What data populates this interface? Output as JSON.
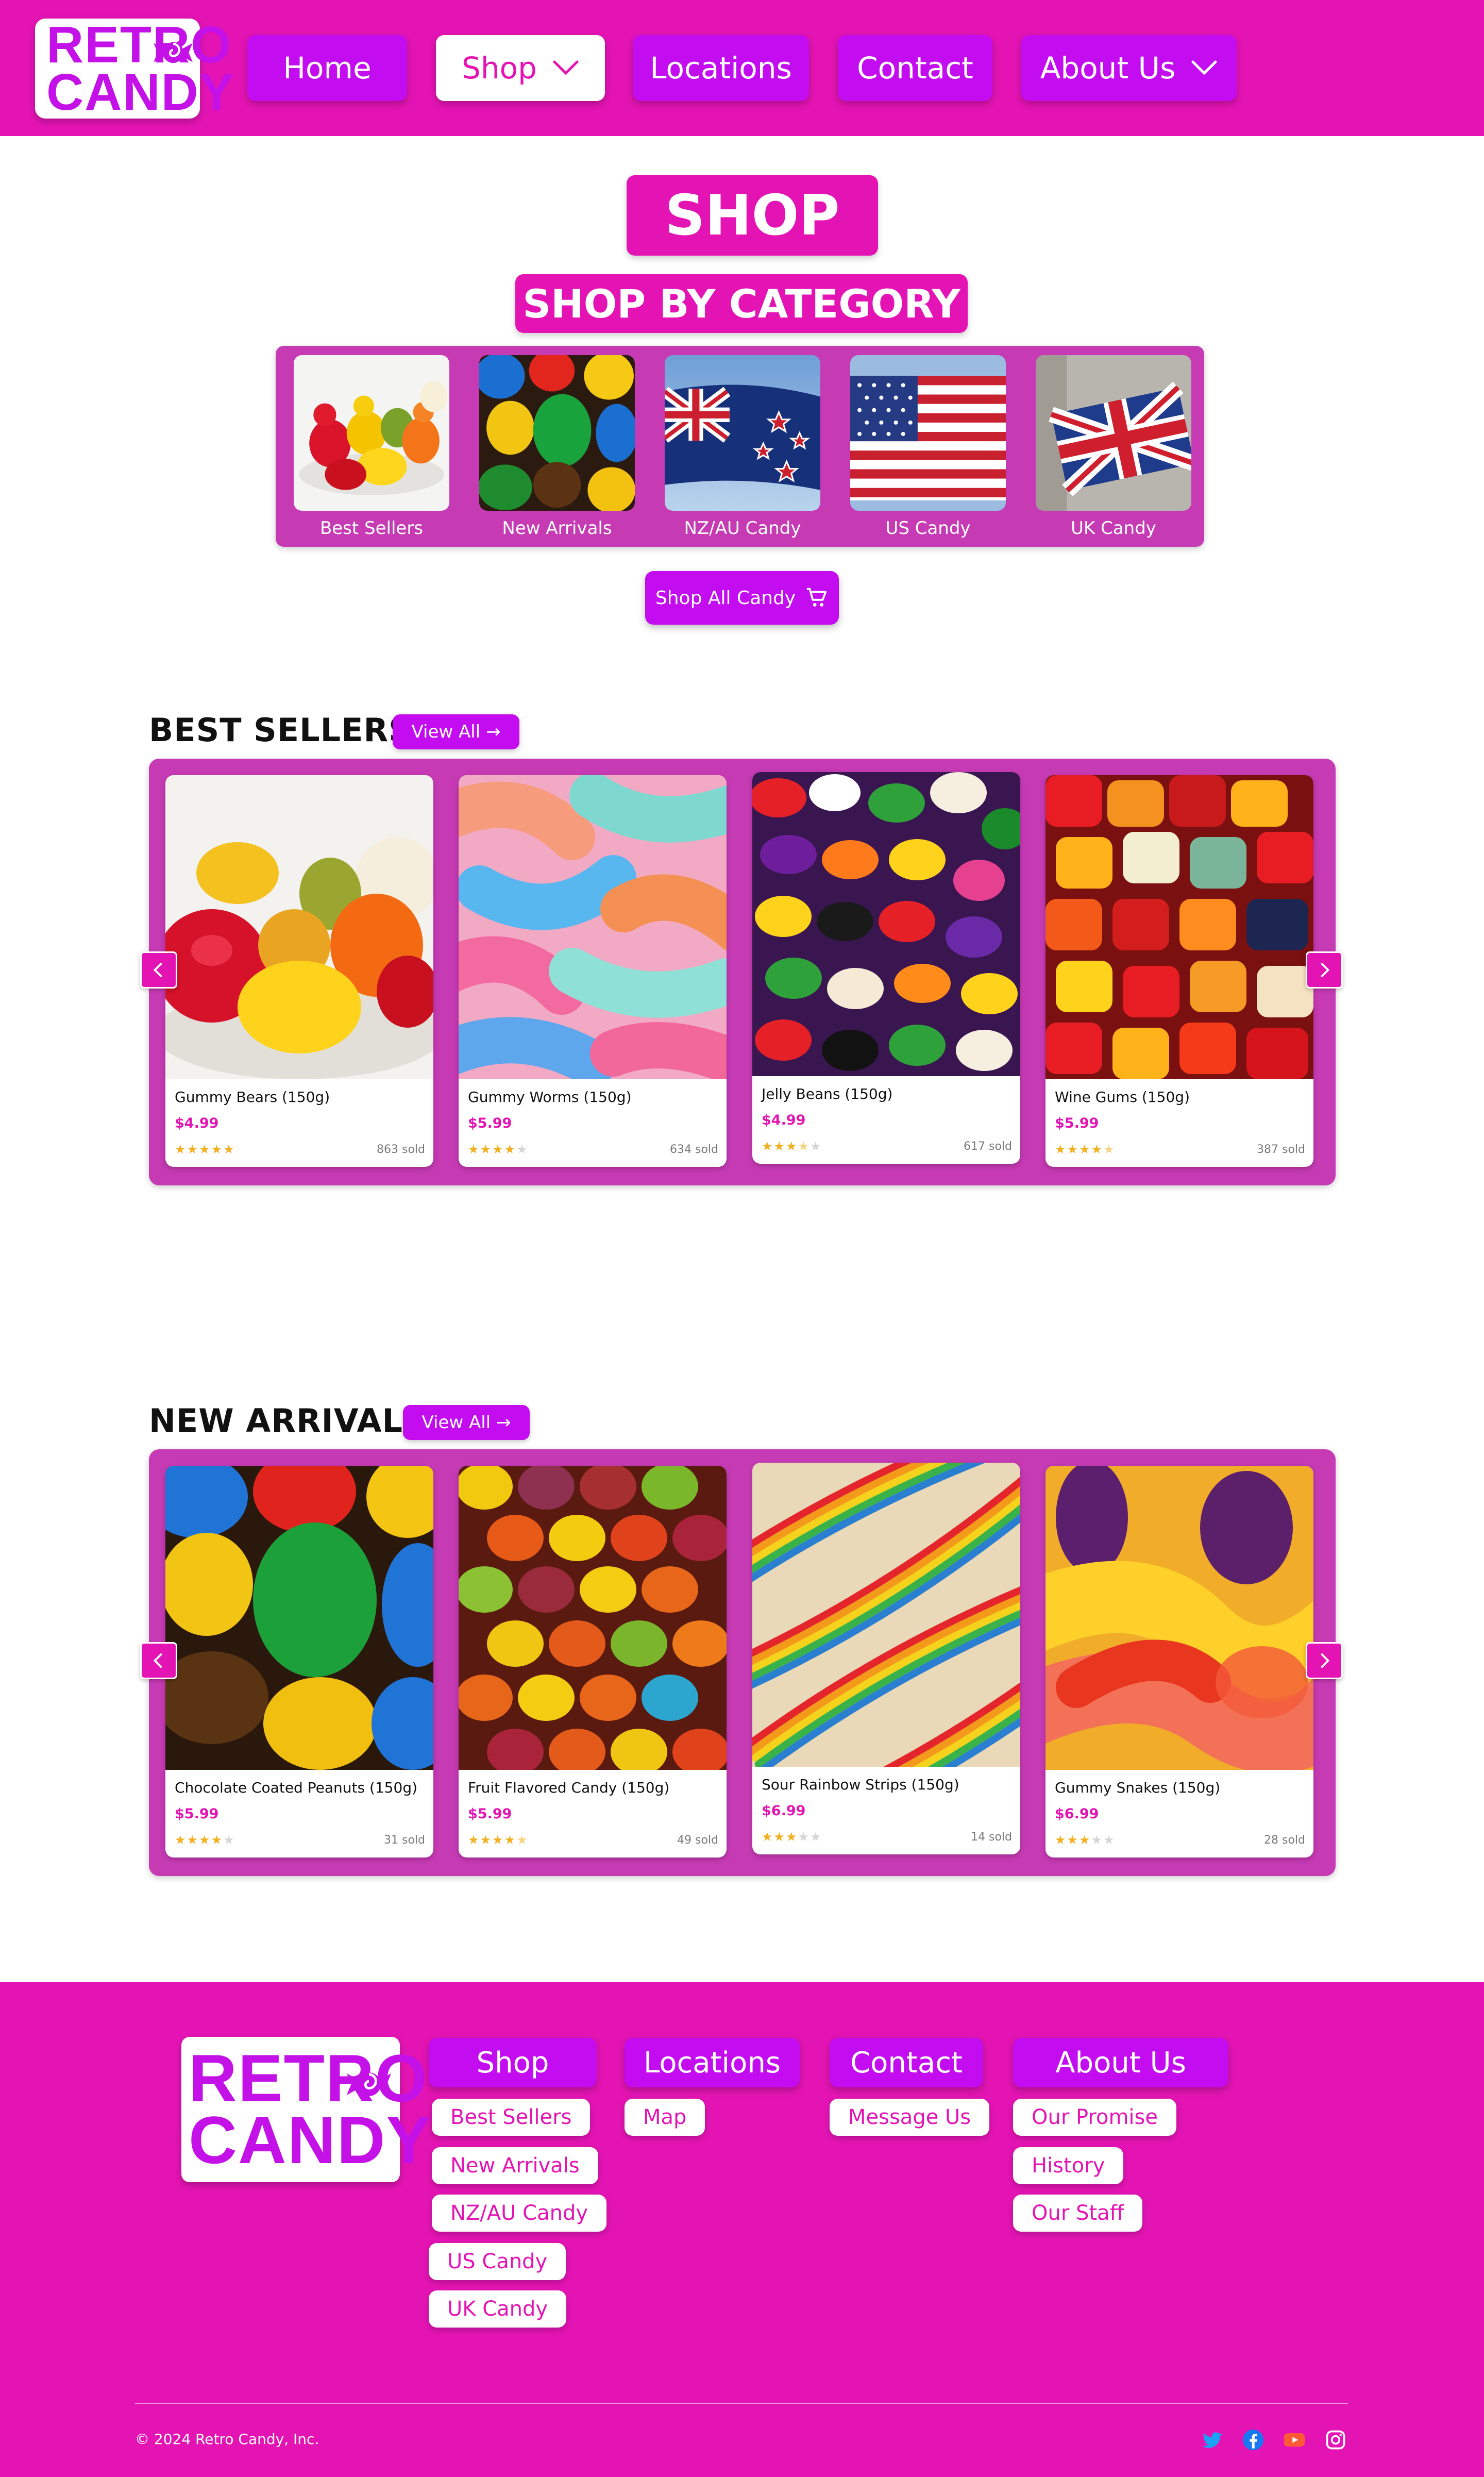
{
  "brand": {
    "logo_line1": "RETRO",
    "logo_line2": "CANDY",
    "accent": "#e414b4",
    "purple": "#c30df0",
    "panel": "#c63ab4"
  },
  "nav": {
    "items": [
      {
        "label": "Home",
        "active": false,
        "dropdown": false
      },
      {
        "label": "Shop",
        "active": true,
        "dropdown": true
      },
      {
        "label": "Locations",
        "active": false,
        "dropdown": false
      },
      {
        "label": "Contact",
        "active": false,
        "dropdown": false
      },
      {
        "label": "About Us",
        "active": false,
        "dropdown": true
      }
    ]
  },
  "page": {
    "title": "SHOP",
    "category_heading": "SHOP BY CATEGORY"
  },
  "categories": [
    {
      "label": "Best Sellers",
      "image": "gummy-bears-image"
    },
    {
      "label": "New Arrivals",
      "image": "chocolate-candies-image"
    },
    {
      "label": "NZ/AU Candy",
      "image": "nz-flag-image"
    },
    {
      "label": "US Candy",
      "image": "us-flag-image"
    },
    {
      "label": "UK Candy",
      "image": "uk-flag-image"
    }
  ],
  "shop_all": {
    "label": "Shop All Candy",
    "icon": "cart-icon"
  },
  "best_sellers": {
    "heading": "BEST SELLERS",
    "view_all": "View All →",
    "products": [
      {
        "name": "Gummy Bears (150g)",
        "price": "$4.99",
        "rating": 5,
        "sold": "863 sold"
      },
      {
        "name": "Gummy Worms (150g)",
        "price": "$5.99",
        "rating": 4,
        "sold": "634 sold"
      },
      {
        "name": "Jelly Beans (150g)",
        "price": "$4.99",
        "rating": 3.5,
        "sold": "617 sold"
      },
      {
        "name": "Wine Gums (150g)",
        "price": "$5.99",
        "rating": 4.5,
        "sold": "387 sold"
      }
    ]
  },
  "new_arrivals": {
    "heading": "NEW ARRIVALS",
    "view_all": "View All →",
    "products": [
      {
        "name": "Chocolate Coated Peanuts (150g)",
        "price": "$5.99",
        "rating": 4,
        "sold": "31 sold"
      },
      {
        "name": "Fruit Flavored Candy (150g)",
        "price": "$5.99",
        "rating": 4.5,
        "sold": "49 sold"
      },
      {
        "name": "Sour Rainbow Strips (150g)",
        "price": "$6.99",
        "rating": 3,
        "sold": "14 sold"
      },
      {
        "name": "Gummy Snakes (150g)",
        "price": "$6.99",
        "rating": 3,
        "sold": "28 sold"
      }
    ]
  },
  "footer": {
    "columns": [
      {
        "heading": "Shop",
        "links": [
          "Best Sellers",
          "New Arrivals",
          "NZ/AU Candy",
          "US Candy",
          "UK Candy"
        ]
      },
      {
        "heading": "Locations",
        "links": [
          "Map"
        ]
      },
      {
        "heading": "Contact",
        "links": [
          "Message Us"
        ]
      },
      {
        "heading": "About Us",
        "links": [
          "Our Promise",
          "History",
          "Our Staff"
        ]
      }
    ],
    "copyright": "© 2024 Retro Candy, Inc.",
    "social": [
      {
        "icon": "twitter-icon",
        "color": "#1da1f2"
      },
      {
        "icon": "facebook-icon",
        "color": "#1877f2"
      },
      {
        "icon": "youtube-icon",
        "color": "#ff5a36"
      },
      {
        "icon": "instagram-icon",
        "color": "#ffffff"
      }
    ]
  }
}
